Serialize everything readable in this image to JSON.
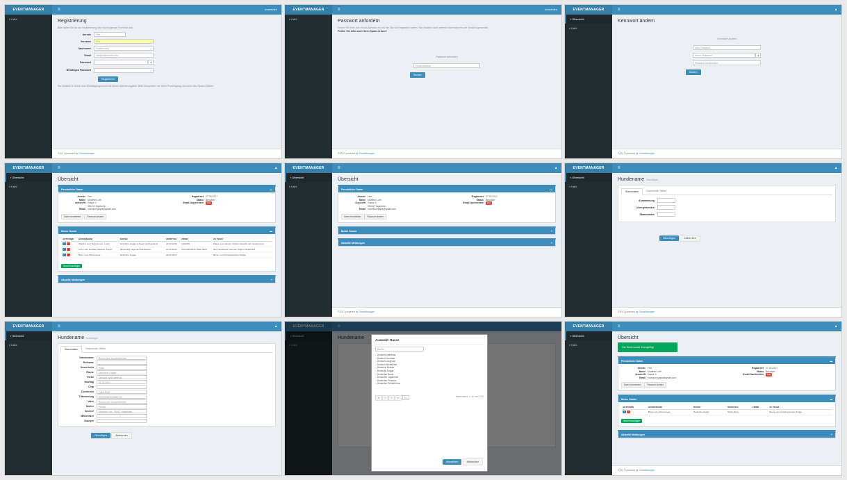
{
  "brand": "EVENTMANAGER",
  "burger": "≡",
  "user_icon_glyph": "♟",
  "footer_prefix": "©2017 powered by ",
  "footer_link": "ShowManager",
  "s1": {
    "top_right": "Anmelden",
    "side": [
      "Kalbi"
    ],
    "title": "Registrierung",
    "intro": "Bitte füllen Sie für die Registrierung das nachfolgende Formular aus.",
    "fields": [
      {
        "label": "Anrede",
        "value": "Herr",
        "type": "select"
      },
      {
        "label": "Vorname",
        "value": "Eva",
        "hl": true
      },
      {
        "label": "Nachname",
        "value": "Mustermann"
      },
      {
        "label": "Email",
        "value": "info@testdomain.info"
      },
      {
        "label": "Passwort",
        "value": ""
      },
      {
        "label": "Bestätigen Passwort",
        "value": ""
      }
    ],
    "button": "Registrieren",
    "note": "Sie erhalten in Kürze eine Bestätigungsemail mit einem Aktivierungslink. Bitte überprüfen Sie Ihren Posteingang und auch den Spam-Ordner!"
  },
  "s2": {
    "top_right": "Anmelden",
    "side": [
      "Kalbi"
    ],
    "title": "Passwort anfordern",
    "intro": "Geben Sie bitte Ihre Email-Adresse ein mit der Sie sich registriert haben. Sie erhalten dann weitere Informationen per Email zugesendet.",
    "intro_bold": "Prüfen Sie bitte auch Ihren Spam-Ordner!",
    "form_title": "Passwort anfordern",
    "email_ph": "Email-Adresse",
    "button": "Senden"
  },
  "s3": {
    "side": [
      "Übersicht",
      "Kalbi"
    ],
    "title": "Kennwort ändern",
    "form_title": "Kennwort ändern",
    "ph": [
      "Altes Passwort",
      "Neues Passwort",
      "Passwort wiederholen"
    ],
    "button": "Ändern"
  },
  "overview": {
    "title": "Übersicht",
    "box_personal": "Persönliche Daten",
    "left": [
      {
        "k": "Anrede",
        "v": "Herr"
      },
      {
        "k": "Name",
        "v": "Manfred Loth"
      },
      {
        "k": "Anschrift",
        "v": "Gasse 4"
      },
      {
        "k": "",
        "v": "95412 Hägelstein"
      },
      {
        "k": "Email",
        "v": "mannlochpapa@gmail.com"
      }
    ],
    "right": [
      {
        "k": "Registriert",
        "v": "27.03.2017"
      },
      {
        "k": "Status",
        "v": "Benutzer"
      },
      {
        "k": "Email-Nachrichten",
        "v": "Aus"
      }
    ],
    "btn_edit": "Daten bearbeiten",
    "btn_pw": "Passwort ändern",
    "box_dogs": "Meine Hunde",
    "box_events": "Aktuelle Meldungen",
    "cols": [
      "AKTIONEN",
      "HUNDENAME",
      "RASSE",
      "WURFTAG",
      "ZB/NR",
      "ZU TEAM"
    ],
    "rows": [
      [
        "Ulleisha vom Teufelsmoor \"Lotta\"",
        "Deutsche Dogge schwarz-weiß gefleckt",
        "30.03.2009",
        "1102456",
        "Welpe vom kleinen Strolch Ulleisha vom Teufelsmoor"
      ],
      [
        "Lotus vom Dorfbach Bianca \"Peppi\"",
        "Mixpunkte Lagerund Weißhelten",
        "01.01.2009",
        "HAN B4048/12 OMA-4528",
        "Die Hundhoebe Hemmel Hugin's Gettlerfeld"
      ],
      [
        "Blenz vom Wiesenreek",
        "Deutsche Dogge",
        "09.01.2012",
        "",
        "Benny vom Kuschelrechen Dogge"
      ]
    ],
    "btn_add": "Hund hinzufügen",
    "success": "Der Hund wurde hinzugefügt"
  },
  "dogform": {
    "title": "Hundename",
    "subtitle": "hinzufügen",
    "tabs": [
      "Stammdaten",
      "Dokumente / Bilder"
    ],
    "labels": [
      "Abstammung",
      "Lebergebunden",
      "Stammdaten"
    ],
    "fields": [
      {
        "k": "Hundename",
        "v": "Benny vom Kuschelrechen"
      },
      {
        "k": "Rufname",
        "v": ""
      },
      {
        "k": "Geschlecht",
        "v": "Rüde"
      },
      {
        "k": "Rasse",
        "v": "Deutsche Dogge"
      },
      {
        "k": "Farbe",
        "v": "schwarz-weiß gefleckt"
      },
      {
        "k": "Wurftag",
        "v": "01.01.2017"
      },
      {
        "k": "Chip",
        "v": ""
      },
      {
        "k": "Zuchtbuch",
        "v": "OMA 4529"
      },
      {
        "k": "Tätowierung",
        "v": "098765432123456789"
      },
      {
        "k": "Vater",
        "v": "Benny vom Kuschelrechen"
      },
      {
        "k": "Mutter",
        "v": "Emma"
      },
      {
        "k": "Züchter",
        "v": "Manfred Loth, 95412 Hägelstein"
      },
      {
        "k": "Mitbesitzer",
        "v": ""
      },
      {
        "k": "Zwinger",
        "v": ""
      }
    ],
    "btn_save": "Hinzufügen",
    "btn_cancel": "Abbrechen"
  },
  "modal": {
    "title": "Auswahl: Rasse",
    "search": "Suche",
    "items": [
      "Deutsch Drahthaar",
      "Deutsch Kurzhaar",
      "Deutsch Langhaar",
      "Deutsch Stichelhaar",
      "Deutsche Bracke",
      "Deutsche Dogge",
      "Deutscher Boxer",
      "Deutscher Jagdterrier",
      "Deutscher Pinscher",
      "Deutscher Schäferhund"
    ],
    "count": "Datensätze 1-10 von 234",
    "btn_select": "Auswählen",
    "btn_cancel": "Abbrechen",
    "per_page": "10"
  }
}
